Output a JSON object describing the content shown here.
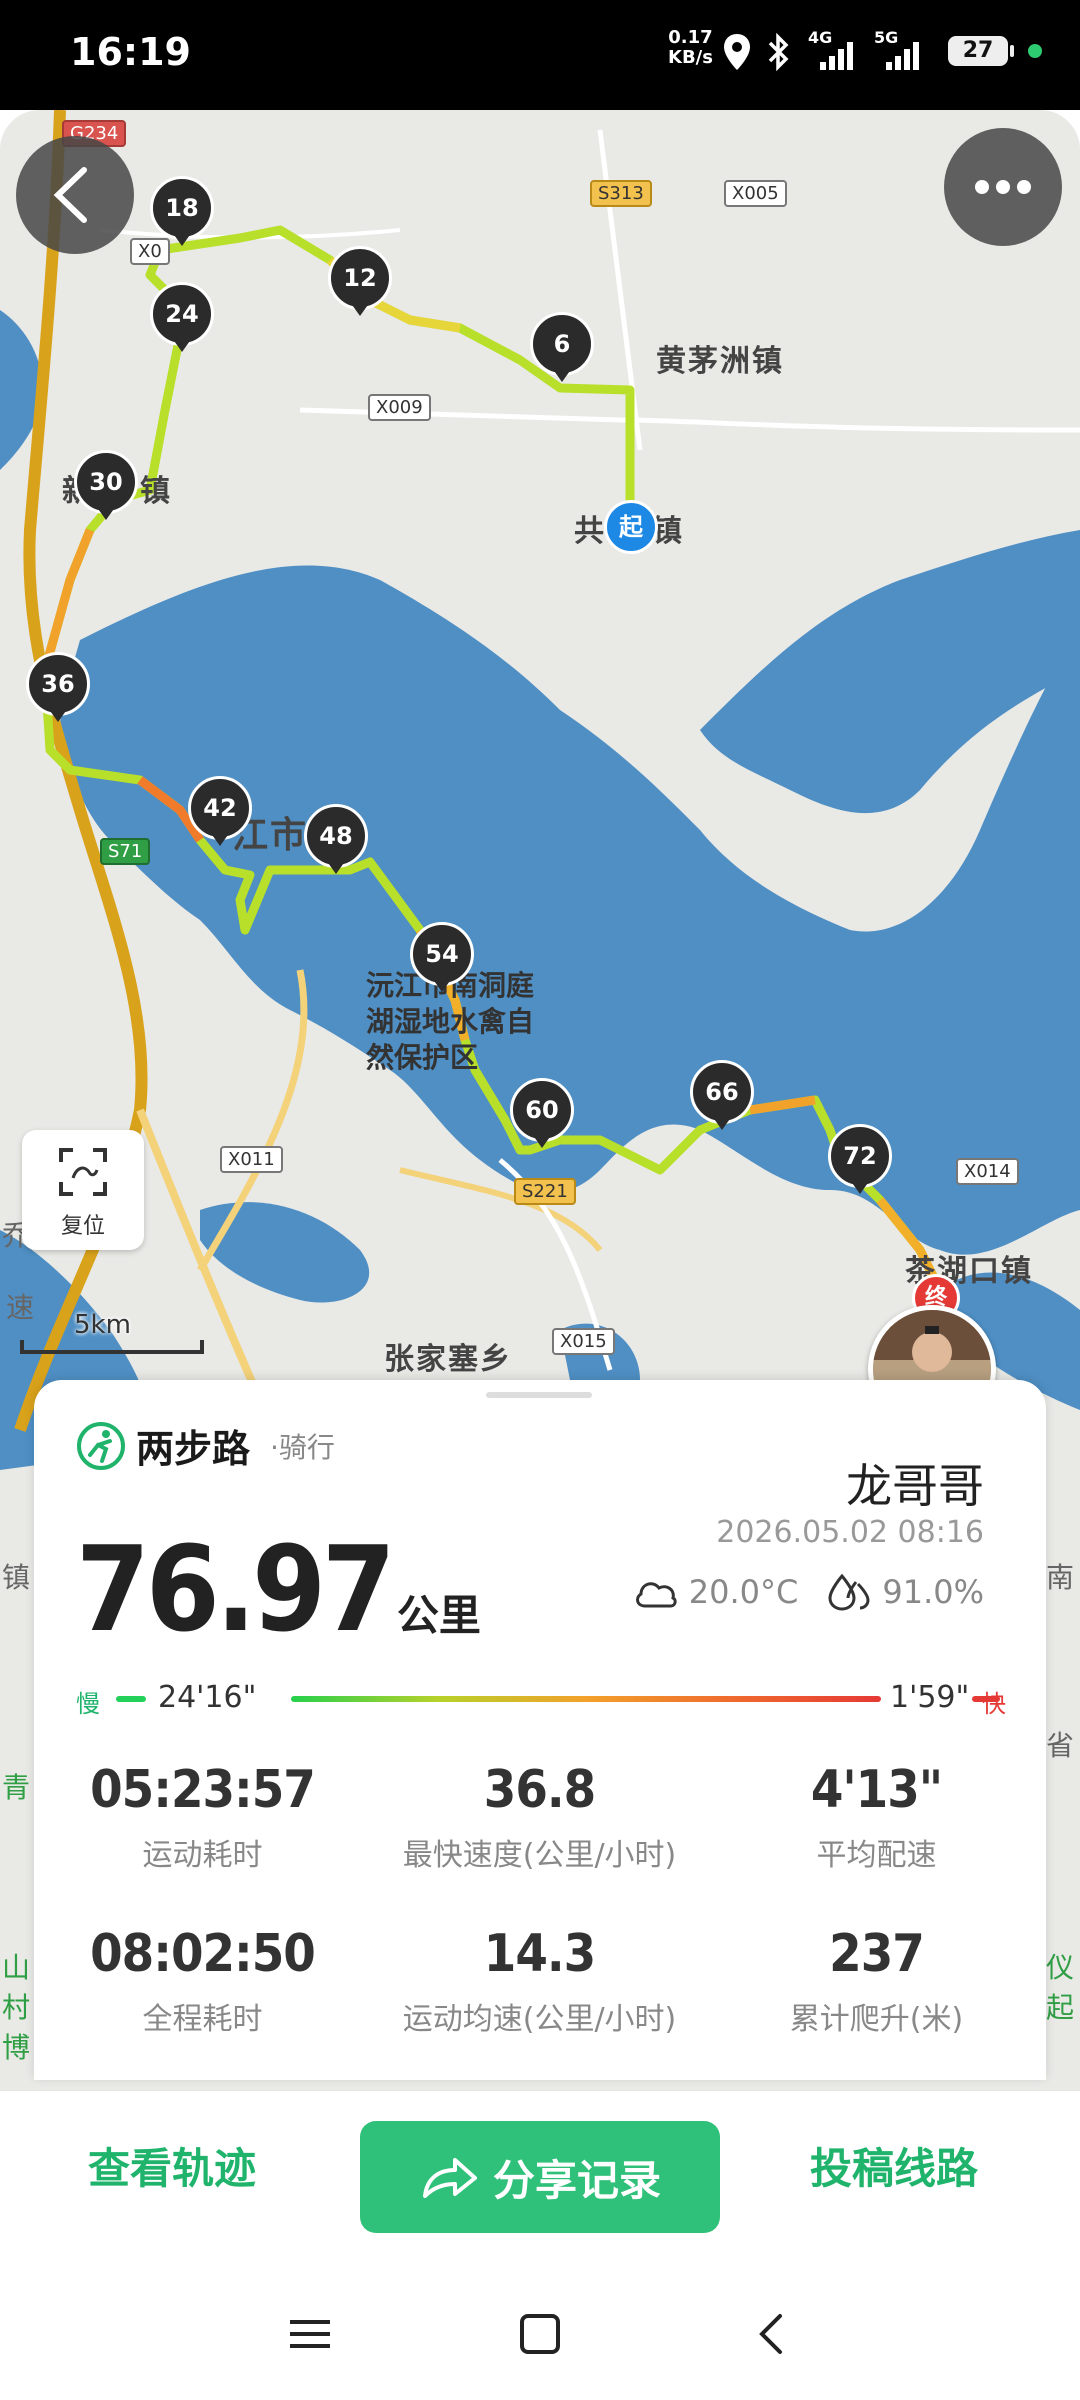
{
  "status_bar": {
    "time": "16:19",
    "net_speed_value": "0.17",
    "net_speed_unit": "KB/s",
    "signal1_gen": "4G",
    "signal2_gen": "5G",
    "battery": "27",
    "icons": [
      "location-icon",
      "bluetooth-icon",
      "signal-4g-icon",
      "signal-5g-icon",
      "battery-icon"
    ]
  },
  "map": {
    "towns": [
      "黄茅洲镇",
      "共",
      "镇",
      "新",
      "镇",
      "江市",
      "张家塞乡",
      "茶湖口镇"
    ],
    "poi": [
      "沅江市南洞庭",
      "湖湿地水禽自",
      "然保护区"
    ],
    "road_tags": [
      "G234",
      "S313",
      "X005",
      "X0",
      "X009",
      "S71",
      "X011",
      "S221",
      "X015",
      "X014"
    ],
    "km_markers": [
      "18",
      "24",
      "30",
      "36",
      "42",
      "48",
      "54",
      "60",
      "66",
      "72",
      "12",
      "6"
    ],
    "start_label": "起",
    "end_label": "终",
    "reset_label": "复位",
    "scale_label": "5km",
    "edge_text": [
      "乔",
      "速",
      "镇",
      "青",
      "山",
      "村",
      "博",
      "仪",
      "起",
      "南",
      "省"
    ]
  },
  "card": {
    "brand_name": "两步路",
    "activity": "·骑行",
    "user_name": "龙哥哥",
    "datetime": "2026.05.02 08:16",
    "distance_value": "76.97",
    "distance_unit": "公里",
    "temperature": "20.0°C",
    "humidity": "91.0%",
    "pace_slow_label": "慢",
    "pace_slow_value": "24'16\"",
    "pace_fast_value": "1'59\"",
    "pace_fast_label": "快",
    "stats": [
      {
        "value": "05:23:57",
        "label": "运动耗时"
      },
      {
        "value": "36.8",
        "label": "最快速度(公里/小时)"
      },
      {
        "value": "4'13\"",
        "label": "平均配速"
      },
      {
        "value": "08:02:50",
        "label": "全程耗时"
      },
      {
        "value": "14.3",
        "label": "运动均速(公里/小时)"
      },
      {
        "value": "237",
        "label": "累计爬升(米)"
      }
    ]
  },
  "actions": {
    "view_track": "查看轨迹",
    "share": "分享记录",
    "submit_route": "投稿线路"
  },
  "colors": {
    "accent_green": "#1fb36b",
    "share_button": "#2fc07a",
    "water": "#4f8fc4",
    "map_land": "#e9e9e6"
  }
}
